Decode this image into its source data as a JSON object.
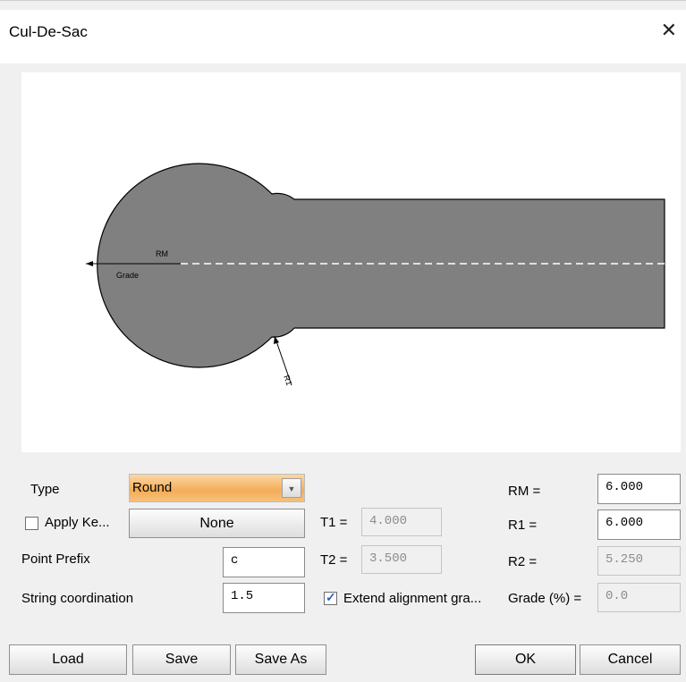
{
  "window": {
    "title": "Cul-De-Sac",
    "close_glyph": "✕"
  },
  "preview": {
    "label_rm": "RM",
    "label_grade": "Grade",
    "label_r1": "R1",
    "fill_color": "#808080"
  },
  "type": {
    "label": "Type",
    "value": "Round",
    "arrow": "▼"
  },
  "apply": {
    "label": "Apply Ke...",
    "checked": false,
    "button_label": "None"
  },
  "t1": {
    "label": "T1 =",
    "value": "4.000"
  },
  "t2": {
    "label": "T2 =",
    "value": "3.500"
  },
  "point_prefix": {
    "label": "Point Prefix",
    "value": "c"
  },
  "string_coord": {
    "label": "String coordination",
    "value": "1.5"
  },
  "extend": {
    "label": "Extend alignment gra...",
    "checked": true,
    "check": "✓"
  },
  "rm": {
    "label": "RM =",
    "value": "6.000"
  },
  "r1": {
    "label": "R1 =",
    "value": "6.000"
  },
  "r2": {
    "label": "R2 =",
    "value": "5.250"
  },
  "grade": {
    "label": "Grade (%) =",
    "value": "0.0"
  },
  "buttons": {
    "load": "Load",
    "save": "Save",
    "save_as": "Save As",
    "ok": "OK",
    "cancel": "Cancel"
  }
}
